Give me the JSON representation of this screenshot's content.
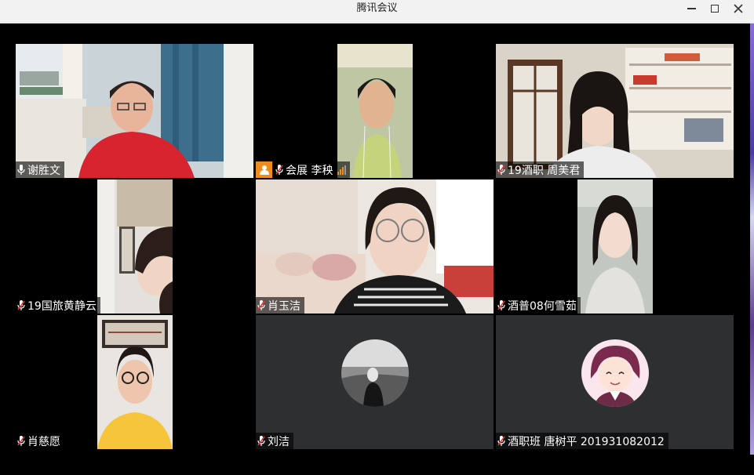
{
  "window": {
    "title": "腾讯会议"
  },
  "controls": {
    "minimize": "minimize",
    "maximize": "maximize",
    "close": "close"
  },
  "participants": [
    {
      "name": "谢胜文",
      "mic": "on"
    },
    {
      "name": "会展 李秧",
      "mic": "off",
      "host": true,
      "signal": true
    },
    {
      "name": "19酒职 周美君",
      "mic": "off"
    },
    {
      "name": "19国旅黄静云",
      "mic": "off"
    },
    {
      "name": "肖玉洁",
      "mic": "off"
    },
    {
      "name": "酒普08何雪茹",
      "mic": "off"
    },
    {
      "name": "肖慈愿",
      "mic": "off"
    },
    {
      "name": "刘洁",
      "mic": "off",
      "camera": "off"
    },
    {
      "name": "酒职班 唐树平 201931082012",
      "mic": "off",
      "camera": "off"
    }
  ],
  "colors": {
    "host_badge": "#f08c1e",
    "tile_gray": "#2d2f31",
    "label_bg": "#000000"
  }
}
